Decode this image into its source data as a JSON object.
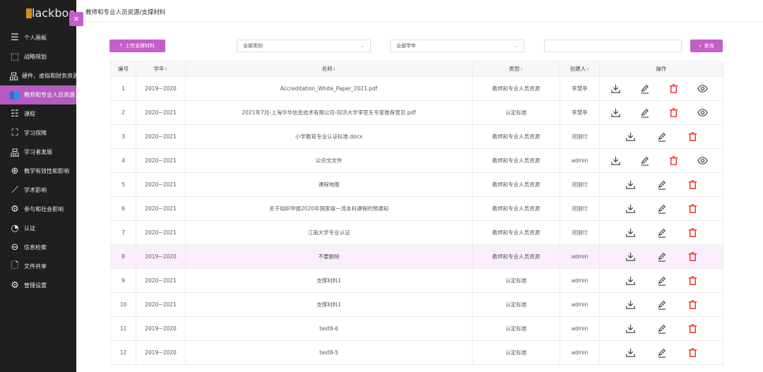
{
  "app": {
    "logo_text": "lackboa",
    "close_label": "×"
  },
  "nav": [
    {
      "icon": "dashboard-icon",
      "glyph": "☰",
      "label": "个人画板"
    },
    {
      "icon": "chart-icon",
      "glyph": "⬚",
      "label": "战略规划"
    },
    {
      "icon": "hierarchy-icon",
      "glyph": "品",
      "label": "硬件、虚拟和财务资源"
    },
    {
      "icon": "people-icon",
      "glyph": "👥",
      "label": "教师和专业人员资源"
    },
    {
      "icon": "list-icon",
      "glyph": "☷",
      "label": "课程"
    },
    {
      "icon": "shield-icon",
      "glyph": "⛶",
      "label": "学习保障"
    },
    {
      "icon": "hierarchy-icon",
      "glyph": "品",
      "label": "学习者发展"
    },
    {
      "icon": "globe-icon",
      "glyph": "⊕",
      "label": "教学有效性和影响"
    },
    {
      "icon": "trend-icon",
      "glyph": "⟋",
      "label": "学术影响"
    },
    {
      "icon": "society-icon",
      "glyph": "⚙",
      "label": "参与和社会影响"
    },
    {
      "icon": "pie-icon",
      "glyph": "◔",
      "label": "认证"
    },
    {
      "icon": "search-circle-icon",
      "glyph": "⊖",
      "label": "信息检索"
    },
    {
      "icon": "file-icon",
      "glyph": "🗋",
      "label": "文件共享"
    },
    {
      "icon": "gear-icon",
      "glyph": "⚙",
      "label": "管理设置"
    }
  ],
  "active_nav_index": 3,
  "breadcrumb": "教师和专业人员资源/支撑材料",
  "toolbar": {
    "upload_label": "上传支撑材料",
    "category_select": "全部类别",
    "year_select": "全部学年",
    "search_value": "",
    "search_label": "查询"
  },
  "table": {
    "headers": [
      "编号",
      "学年",
      "名称",
      "类型",
      "创建人",
      "操作"
    ],
    "rows": [
      {
        "id": "1",
        "year": "2019~2020",
        "name": "Accreditation_White_Paper_2021.pdf",
        "type": "教师和专业人员资源",
        "creator": "李慧亭",
        "view": true
      },
      {
        "id": "2",
        "year": "2020~2021",
        "name": "2021年7月-上海华华信息技术有限公司-同济大学李亚东专家推荐意见.pdf",
        "type": "认定标准",
        "creator": "李慧亭",
        "view": true
      },
      {
        "id": "3",
        "year": "2020~2021",
        "name": "小学教育专业认证标准.docx",
        "type": "教师和专业人员资源",
        "creator": "迟国付",
        "view": false
      },
      {
        "id": "4",
        "year": "2020~2021",
        "name": "公示文文件",
        "type": "教师和专业人员资源",
        "creator": "admin",
        "view": true
      },
      {
        "id": "5",
        "year": "2020~2021",
        "name": "课程地图",
        "type": "教师和专业人员资源",
        "creator": "迟国付",
        "view": false
      },
      {
        "id": "6",
        "year": "2020~2021",
        "name": "关于组织申报2020年国家级一流本科课程的预通知",
        "type": "教师和专业人员资源",
        "creator": "迟国付",
        "view": false
      },
      {
        "id": "7",
        "year": "2020~2021",
        "name": "江南大学专业认证",
        "type": "教师和专业人员资源",
        "creator": "迟国付",
        "view": false
      },
      {
        "id": "8",
        "year": "2019~2020",
        "name": "不要删除",
        "type": "教师和专业人员资源",
        "creator": "admin",
        "view": false,
        "highlight": true
      },
      {
        "id": "9",
        "year": "2020~2021",
        "name": "支撑材料1",
        "type": "认定标准",
        "creator": "admin",
        "view": false
      },
      {
        "id": "10",
        "year": "2020~2021",
        "name": "支撑材料1",
        "type": "认定标准",
        "creator": "admin",
        "view": false
      },
      {
        "id": "11",
        "year": "2019~2020",
        "name": "test8-6",
        "type": "认定标准",
        "creator": "admin",
        "view": false
      },
      {
        "id": "12",
        "year": "2019~2020",
        "name": "test8-5",
        "type": "认定标准",
        "creator": "admin",
        "view": false
      }
    ]
  },
  "colors": {
    "accent": "#c45ec9",
    "delete": "#e53935",
    "sidebar_bg": "#1f1f1f"
  }
}
